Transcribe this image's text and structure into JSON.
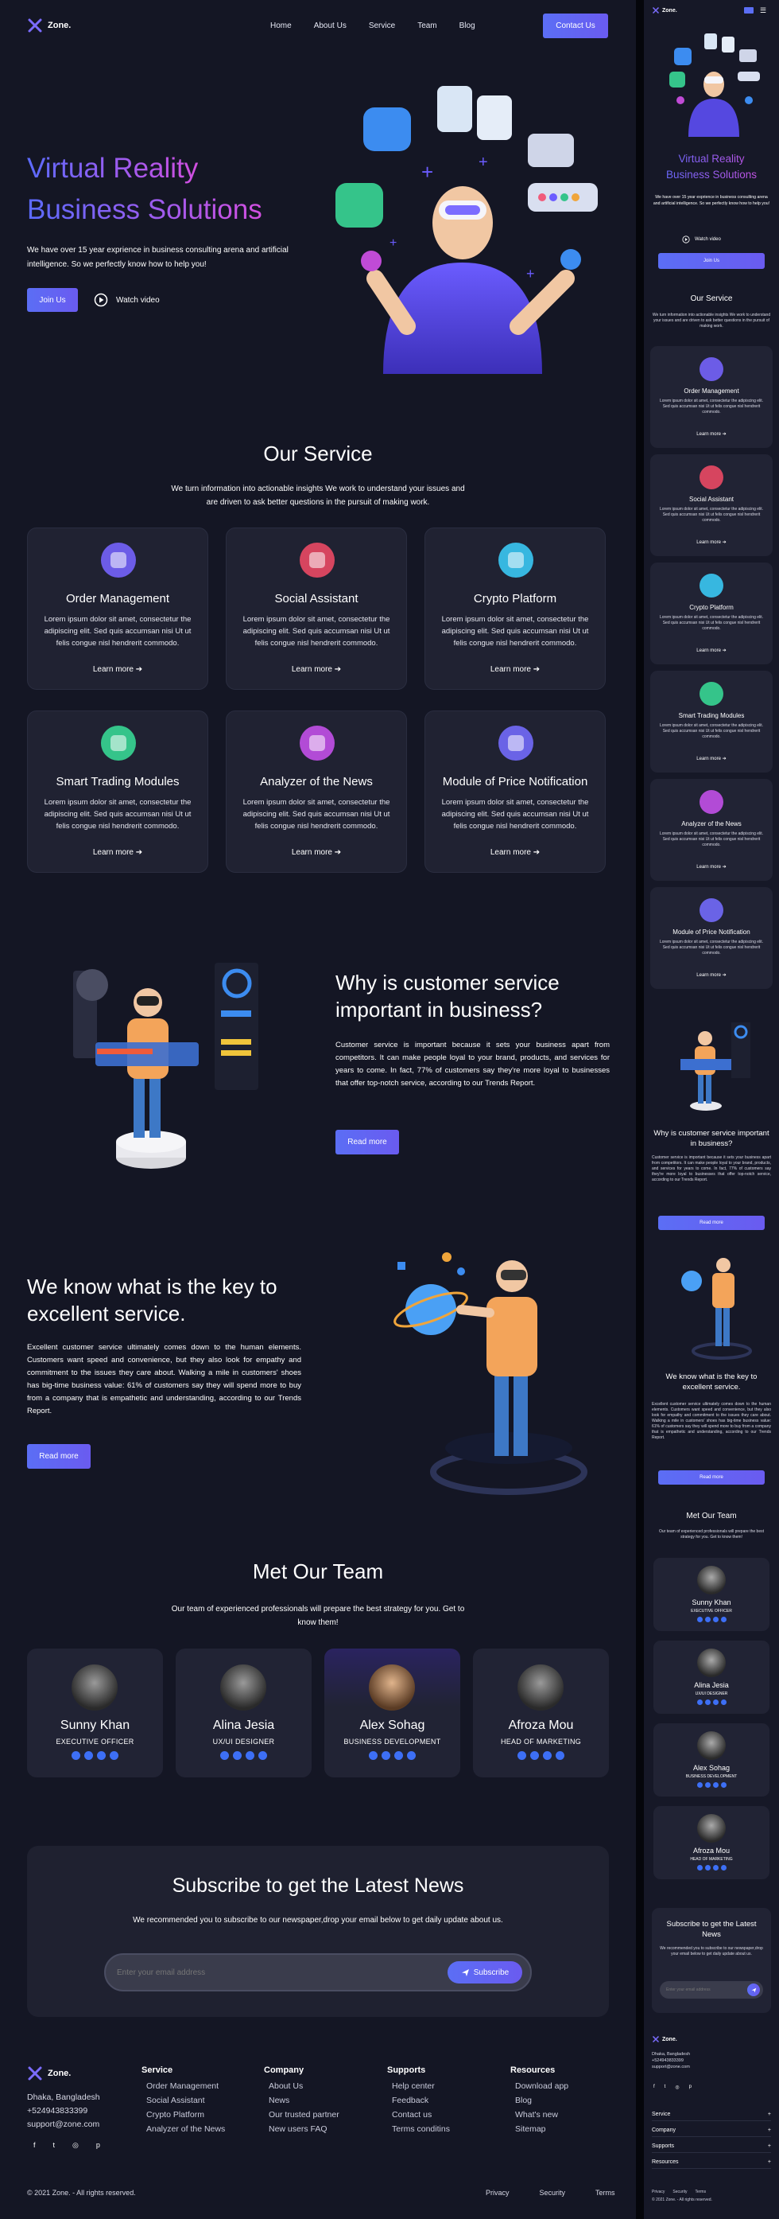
{
  "brand": {
    "name": "Zone."
  },
  "nav": {
    "items": [
      "Home",
      "About Us",
      "Service",
      "Team",
      "Blog"
    ],
    "cta": "Contact Us"
  },
  "hero": {
    "title_line1": "Virtual Reality",
    "title_line2": "Business Solutions",
    "text": "We have over 15 year exprience in business consulting arena and artificial intelligence. So we perfectly know how to help you!",
    "join": "Join Us",
    "watch": "Watch video"
  },
  "service": {
    "title": "Our Service",
    "subtitle": "We turn information into actionable insights We work to understand your issues and are driven to ask better questions in the pursuit of making work.",
    "body": "Lorem ipsum dolor sit amet, consectetur the adipiscing elit. Sed quis accumsan nisi Ut ut felis congue nisl hendrerit commodo.",
    "learn": "Learn more",
    "cards": [
      {
        "title": "Order Management",
        "color": "#6c5ce7"
      },
      {
        "title": "Social Assistant",
        "color": "#d6455f"
      },
      {
        "title": "Crypto Platform",
        "color": "#37b7e0"
      },
      {
        "title": "Smart Trading Modules",
        "color": "#35c48a"
      },
      {
        "title": "Analyzer of the News",
        "color": "#b24bd6"
      },
      {
        "title": "Module of Price Notification",
        "color": "#6a63e6"
      }
    ]
  },
  "why": {
    "title": "Why is customer service important in business?",
    "text": "Customer service is important because it sets your business apart from competitors. It can make people loyal to your brand, products, and services for years to come. In fact, 77% of customers say they're more loyal to businesses that offer top-notch service, according to our Trends Report.",
    "button": "Read more"
  },
  "key": {
    "title": "We know what is the key to excellent service.",
    "text": "Excellent customer service ultimately comes down to the human elements. Customers want speed and convenience, but they also look for empathy and commitment to the issues they care about. Walking a mile in customers' shoes has big-time business value: 61% of customers say they will spend more to buy from a company that is empathetic and understanding, according to our Trends Report.",
    "button": "Read more"
  },
  "team": {
    "title": "Met Our Team",
    "subtitle": "Our team of experienced professionals will prepare the best strategy for you. Get to know them!",
    "members": [
      {
        "name": "Sunny Khan",
        "role": "EXECUTIVE OFFICER"
      },
      {
        "name": "Alina Jesia",
        "role": "UX/UI DESIGNER"
      },
      {
        "name": "Alex Sohag",
        "role": "BUSINESS DEVELOPMENT"
      },
      {
        "name": "Afroza Mou",
        "role": "HEAD OF MARKETING"
      }
    ]
  },
  "subscribe": {
    "title": "Subscribe to get the Latest News",
    "text": "We recommended you to subscribe to our newspaper,drop your email below to get daily update about us.",
    "placeholder": "Enter your email address",
    "button": "Subscribe"
  },
  "footer": {
    "address": "Dhaka, Bangladesh",
    "phone": "+524943833399",
    "email": "support@zone.com",
    "cols": [
      {
        "title": "Service",
        "items": [
          "Order Management",
          "Social Assistant",
          "Crypto Platform",
          "Analyzer of the News"
        ]
      },
      {
        "title": "Company",
        "items": [
          "About Us",
          "News",
          "Our trusted partner",
          "New users FAQ"
        ]
      },
      {
        "title": "Supports",
        "items": [
          "Help center",
          "Feedback",
          "Contact us",
          "Terms conditins"
        ]
      },
      {
        "title": "Resources",
        "items": [
          "Download app",
          "Blog",
          "What's new",
          "Sitemap"
        ]
      }
    ],
    "copyright": "© 2021 Zone. - All rights reserved.",
    "legal": [
      "Privacy",
      "Security",
      "Terms"
    ]
  },
  "mobile": {
    "phone": "+524943833399",
    "address": "Dhaka, Bangladesh",
    "email": "support@zone.com",
    "accordion": [
      "Service",
      "Company",
      "Supports",
      "Resources"
    ],
    "copyright": "© 2021 Zone. - All rights reserved."
  }
}
